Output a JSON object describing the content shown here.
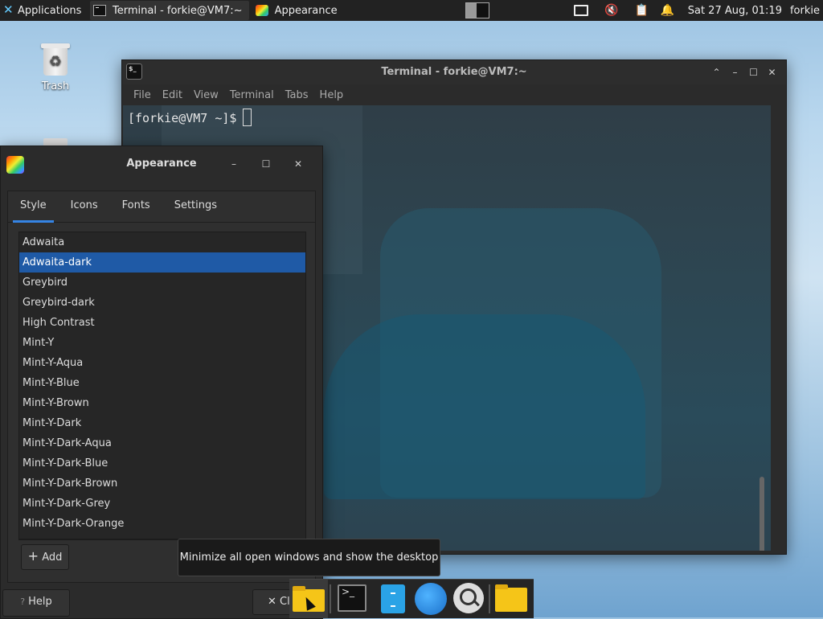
{
  "top_panel": {
    "applications_label": "Applications",
    "tasks": [
      {
        "label": "Terminal - forkie@VM7:~",
        "icon": "terminal-icon"
      },
      {
        "label": "Appearance",
        "icon": "appearance-icon"
      }
    ],
    "clock": "Sat 27 Aug, 01:19",
    "user": "forkie"
  },
  "desktop": {
    "trash_label": "Trash"
  },
  "terminal": {
    "title": "Terminal - forkie@VM7:~",
    "menu": [
      "File",
      "Edit",
      "View",
      "Terminal",
      "Tabs",
      "Help"
    ],
    "prompt": "[forkie@VM7 ~]$"
  },
  "appearance": {
    "title": "Appearance",
    "tabs": [
      "Style",
      "Icons",
      "Fonts",
      "Settings"
    ],
    "active_tab": "Style",
    "themes": [
      "Adwaita",
      "Adwaita-dark",
      "Greybird",
      "Greybird-dark",
      "High Contrast",
      "Mint-Y",
      "Mint-Y-Aqua",
      "Mint-Y-Blue",
      "Mint-Y-Brown",
      "Mint-Y-Dark",
      "Mint-Y-Dark-Aqua",
      "Mint-Y-Dark-Blue",
      "Mint-Y-Dark-Brown",
      "Mint-Y-Dark-Grey",
      "Mint-Y-Dark-Orange"
    ],
    "selected_theme": "Adwaita-dark",
    "add_label": "Add",
    "help_label": "Help",
    "close_label": "Cl"
  },
  "tooltip": "Minimize all open windows and show the desktop",
  "colors": {
    "selection": "#1f5aa6",
    "tab_indicator": "#3584e4",
    "panel": "#222222"
  }
}
